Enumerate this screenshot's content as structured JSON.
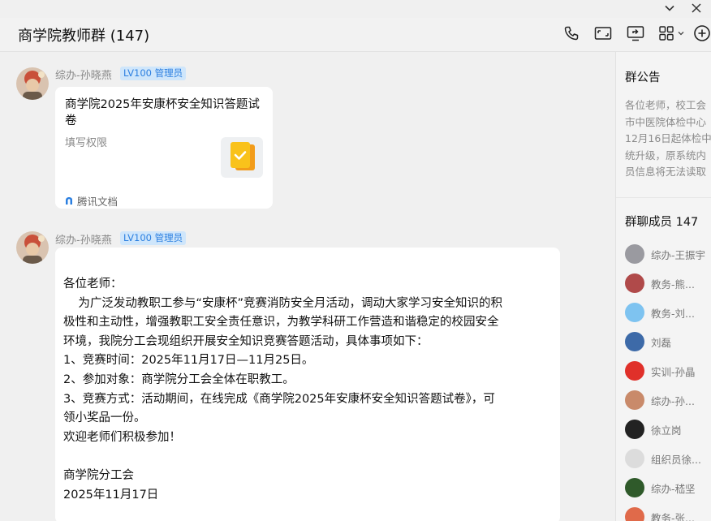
{
  "window": {
    "chevron_icon": "chevron-down-icon",
    "close_icon": "close-icon"
  },
  "header": {
    "title": "商学院教师群 (147)",
    "icons": [
      "phone-icon",
      "video-icon",
      "screen-share-icon",
      "apps-grid-icon",
      "add-icon"
    ]
  },
  "messages": [
    {
      "sender": "综办-孙晓燕",
      "badge": "LV100 管理员",
      "type": "doc-card",
      "doc_title": "商学院2025年安康杯安全知识答题试卷",
      "permission": "填写权限",
      "source": "腾讯文档",
      "thumb_icon": "form-check-icon",
      "source_icon": "tencent-docs-icon"
    },
    {
      "sender": "综办-孙晓燕",
      "badge": "LV100 管理员",
      "type": "text",
      "lines": [
        "各位老师：",
        "    为广泛发动教职工参与“安康杯”竞赛消防安全月活动，调动大家学习安全知识的积",
        "极性和主动性，增强教职工安全责任意识，为教学科研工作营造和谐稳定的校园安全",
        "环境，我院分工会现组织开展安全知识竞赛答题活动，具体事项如下：",
        "1、竞赛时间：2025年11月17日—11月25日。",
        "2、参加对象：商学院分工会全体在职教工。",
        "3、竞赛方式：活动期间，在线完成《商学院2025年安康杯安全知识答题试卷》，可",
        "领小奖品一份。",
        "欢迎老师们积极参加！",
        "",
        "商学院分工会",
        "2025年11月17日"
      ]
    }
  ],
  "sidebar": {
    "notice_title": "群公告",
    "notice_lines": [
      "各位老师，校工会",
      "市中医院体检中心",
      "12月16日起体检中",
      "统升级，原系统内",
      "员信息将无法读取"
    ],
    "members_title": "群聊成员 147",
    "members": [
      {
        "name": "综办-王振宇",
        "avatar_color": "#9a9aa0"
      },
      {
        "name": "教务-熊...",
        "avatar_color": "#b04a4a"
      },
      {
        "name": "教务-刘...",
        "avatar_color": "#7ec3f0"
      },
      {
        "name": "刘磊",
        "avatar_color": "#3d6aa8"
      },
      {
        "name": "实训-孙晶",
        "avatar_color": "#e0302a"
      },
      {
        "name": "综办-孙...",
        "avatar_color": "#c98a6a"
      },
      {
        "name": "徐立岗",
        "avatar_color": "#222222"
      },
      {
        "name": "组织员徐...",
        "avatar_color": "#dcdcdc"
      },
      {
        "name": "综办-嵇坚",
        "avatar_color": "#2f5a2a"
      },
      {
        "name": "教务-张...",
        "avatar_color": "#e06a4a"
      }
    ]
  },
  "colors": {
    "accent": "#2b7fe0",
    "badge_bg": "#cfe6fb",
    "doc_icon": "#f7b500"
  }
}
